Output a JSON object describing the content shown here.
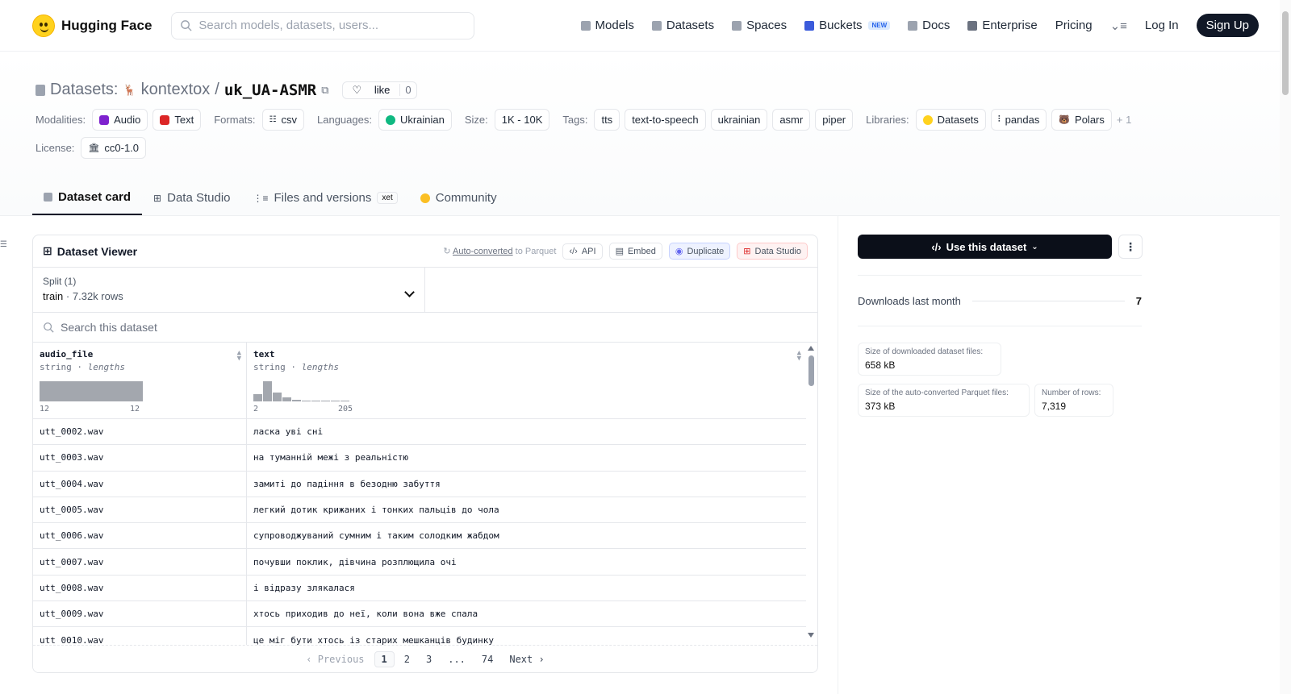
{
  "nav": {
    "brand": "Hugging Face",
    "search_placeholder": "Search models, datasets, users...",
    "links": [
      "Models",
      "Datasets",
      "Spaces",
      "Buckets",
      "Docs",
      "Enterprise",
      "Pricing"
    ],
    "buckets_badge": "NEW",
    "login": "Log In",
    "signup": "Sign Up"
  },
  "header": {
    "prefix": "Datasets:",
    "owner": "kontextox",
    "sep": "/",
    "name": "uk_UA-ASMR",
    "like_label": "like",
    "like_count": "0",
    "modalities_label": "Modalities:",
    "modalities": [
      "Audio",
      "Text"
    ],
    "formats_label": "Formats:",
    "formats": [
      "csv"
    ],
    "languages_label": "Languages:",
    "languages": [
      "Ukrainian"
    ],
    "size_label": "Size:",
    "size": "1K - 10K",
    "tags_label": "Tags:",
    "tags": [
      "tts",
      "text-to-speech",
      "ukrainian",
      "asmr",
      "piper"
    ],
    "libraries_label": "Libraries:",
    "libraries": [
      "Datasets",
      "pandas",
      "Polars"
    ],
    "libraries_more": "+ 1",
    "license_label": "License:",
    "license": "cc0-1.0"
  },
  "tabs": [
    "Dataset card",
    "Data Studio",
    "Files and versions",
    "Community"
  ],
  "xet_badge": "xet",
  "viewer": {
    "title": "Dataset Viewer",
    "auto_converted": "Auto-converted",
    "to_parquet": "to Parquet",
    "api": "API",
    "embed": "Embed",
    "duplicate": "Duplicate",
    "data_studio": "Data Studio",
    "split_label": "Split (1)",
    "split_value": "train",
    "split_rows": "7.32k rows",
    "search_placeholder": "Search this dataset",
    "columns": [
      {
        "name": "audio_file",
        "type": "string",
        "stat": "lengths",
        "min": "12",
        "max": "12"
      },
      {
        "name": "text",
        "type": "string",
        "stat": "lengths",
        "min": "2",
        "max": "205"
      }
    ],
    "histogram_text": [
      0.35,
      1.0,
      0.45,
      0.2,
      0.08,
      0.04,
      0.04,
      0.04,
      0.04,
      0.04
    ],
    "rows": [
      [
        "utt_0002.wav",
        "ласка уві сні"
      ],
      [
        "utt_0003.wav",
        "на туманній межі з реальністю"
      ],
      [
        "utt_0004.wav",
        "замиті до падіння в безодню забуття"
      ],
      [
        "utt_0005.wav",
        "легкий дотик крижаних і тонких пальців до чола"
      ],
      [
        "utt_0006.wav",
        "супроводжуваний сумним і таким солодким жабдом"
      ],
      [
        "utt_0007.wav",
        "почувши поклик, дівчина розплющила очі"
      ],
      [
        "utt_0008.wav",
        "і відразу злякалася"
      ],
      [
        "utt_0009.wav",
        "хтось приходив до неї, коли вона вже спала"
      ],
      [
        "utt_0010.wav",
        "це міг бути хтось із старих мешканців будинку"
      ]
    ],
    "pager": {
      "prev": "Previous",
      "pages": [
        "1",
        "2",
        "3",
        "...",
        "74"
      ],
      "next": "Next"
    }
  },
  "sidebar": {
    "use_dataset": "Use this dataset",
    "downloads_label": "Downloads last month",
    "downloads_value": "7",
    "stats": [
      {
        "label": "Size of downloaded dataset files:",
        "value": "658 kB"
      },
      {
        "label": "Size of the auto-converted Parquet files:",
        "value": "373 kB"
      },
      {
        "label": "Number of rows:",
        "value": "7,319"
      }
    ]
  }
}
